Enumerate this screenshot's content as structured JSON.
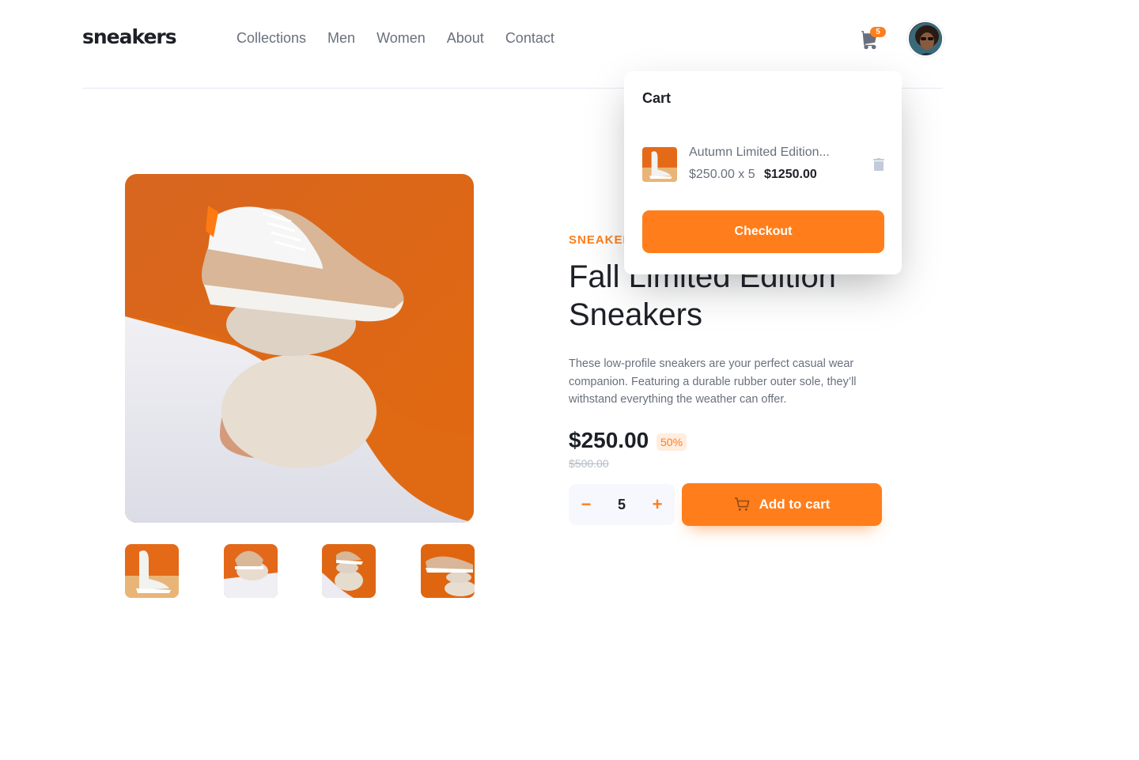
{
  "header": {
    "logo": "sneakers",
    "nav": [
      "Collections",
      "Men",
      "Women",
      "About",
      "Contact"
    ],
    "cart_count": "5"
  },
  "product": {
    "company": "SNEAKER COMPANY",
    "title": "Fall Limited Edition Sneakers",
    "description": "These low-profile sneakers are your perfect casual wear companion. Featuring a durable rubber outer sole, they’ll withstand everything the weather can offer.",
    "price": "$250.00",
    "discount": "50%",
    "old_price": "$500.00",
    "quantity": "5",
    "add_to_cart": "Add to cart",
    "qty_minus": "−",
    "qty_plus": "+"
  },
  "cart": {
    "title": "Cart",
    "item_name": "Autumn Limited Edition...",
    "item_calc": "$250.00 x 5",
    "item_total": "$1250.00",
    "checkout": "Checkout"
  },
  "colors": {
    "accent": "#ff7e1b",
    "accent_pale": "#ffede0",
    "text_dark": "#1d2026",
    "text_grey": "#69707d"
  }
}
